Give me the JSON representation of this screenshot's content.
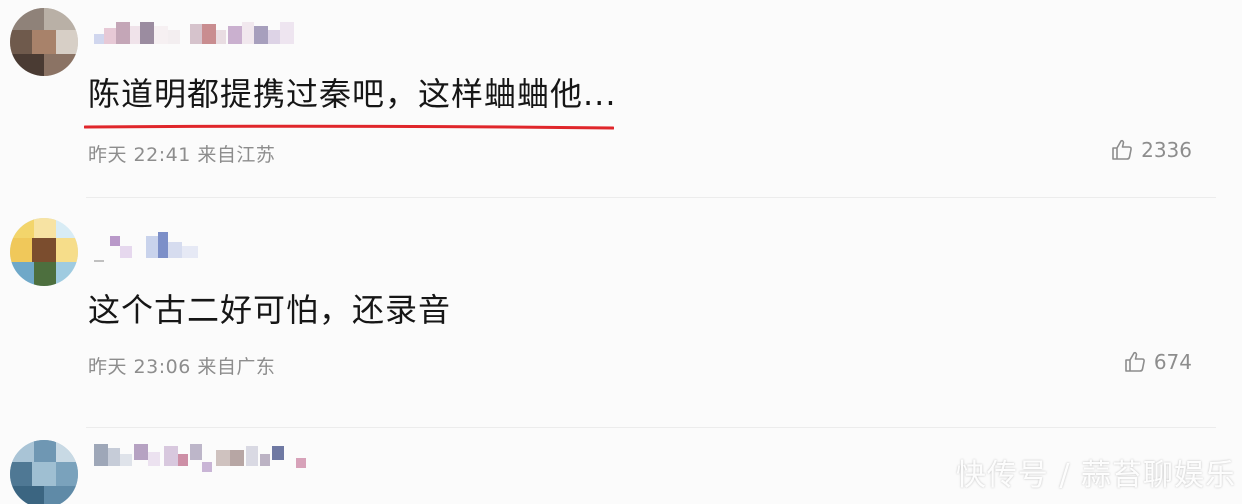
{
  "comments": [
    {
      "text": "陈道明都提携过秦吧，这样蛐蛐他...",
      "meta": "昨天 22:41 来自江苏",
      "likes": "2336"
    },
    {
      "text": "这个古二好可怕，还录音",
      "meta": "昨天 23:06 来自广东",
      "likes": "674"
    }
  ],
  "watermark": "快传号 / 蒜苔聊娱乐",
  "colors": {
    "underline": "#e0262b",
    "meta_text": "#8d8d8d",
    "background": "#fbfbfb"
  },
  "icons": {
    "like": "thumbs-up-icon"
  }
}
